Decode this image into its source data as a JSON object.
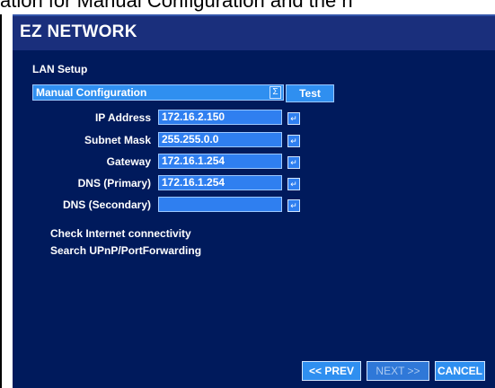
{
  "caption_fragment": "ation for Manual Configuration and the n",
  "window": {
    "title": "EZ NETWORK"
  },
  "lan": {
    "section_label": "LAN Setup",
    "mode_value": "Manual Configuration",
    "test_label": "Test"
  },
  "fields": [
    {
      "label": "IP Address",
      "value": "172.16.2.150"
    },
    {
      "label": "Subnet Mask",
      "value": "255.255.0.0"
    },
    {
      "label": "Gateway",
      "value": "172.16.1.254"
    },
    {
      "label": "DNS (Primary)",
      "value": "172.16.1.254"
    },
    {
      "label": "DNS (Secondary)",
      "value": ""
    }
  ],
  "links": {
    "check_internet": "Check Internet connectivity",
    "search_upnp": "Search UPnP/PortForwarding"
  },
  "nav": {
    "prev": "<< PREV",
    "next": "NEXT >>",
    "cancel": "CANCEL"
  },
  "icons": {
    "dropdown": "dropdown-arrow-icon",
    "enter": "enter-icon"
  },
  "colors": {
    "panel_bg": "#001a5c",
    "field_bg": "#2f7ff0",
    "accent": "#2f8ff0"
  }
}
